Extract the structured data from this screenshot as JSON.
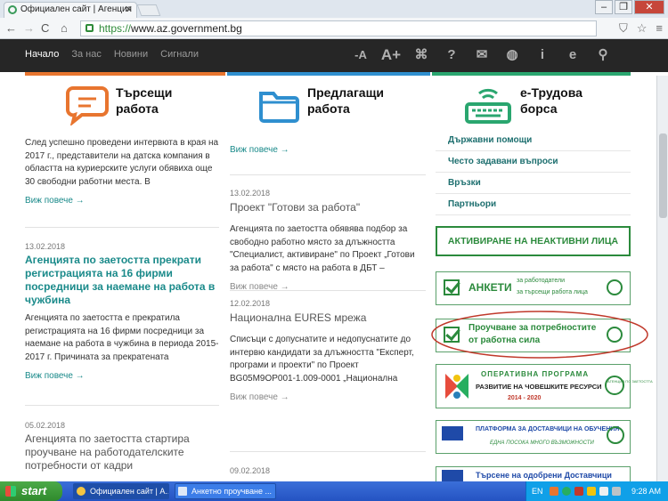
{
  "browser": {
    "tab_title": "Официален сайт | Агенция",
    "url_scheme": "https://",
    "url_host": "www.az.government.bg"
  },
  "site_nav": {
    "links": [
      "Начало",
      "За нас",
      "Новини",
      "Сигнали"
    ],
    "tools": [
      "-A",
      "A+",
      "⌘",
      "?",
      "✉",
      "◍",
      "i",
      "e",
      "⚲"
    ]
  },
  "hero": {
    "job_seekers": "Търсещи работа",
    "offering_jobs": "Предлагащи работа",
    "e_exchange": "е-Трудова борса"
  },
  "colors": {
    "orange": "#e8752f",
    "blue": "#2f8fcf",
    "green": "#2aa66f",
    "teal": "#1a8a8a"
  },
  "left_column": {
    "intro_text": "След успешно проведени интервюта в края на 2017 г., представители на датска компания в областта на куриерските услуги обявиха още 30 свободни работни места. В",
    "more_label": "Виж повече  →",
    "article2": {
      "date": "13.02.2018",
      "title": "Агенцията по заетостта прекрати регистрацията на 16 фирми посредници за наемане на работа в чужбина",
      "text": "Агенцията по заетостта е прекратила регистрацията на 16 фирми посредници за наемане на работа в чужбина в периода 2015-2017 г. Причината за прекратената"
    },
    "article3": {
      "date": "05.02.2018",
      "title": "Агенцията по заетостта стартира проучване на работодателските потребности от кадри"
    }
  },
  "middle_column": {
    "more_label": "Виж повече  →",
    "article1": {
      "date": "13.02.2018",
      "title": "Проект \"Готови за работа\"",
      "text": "Агенцията по заетостта обявява подбор за свободно работно място за длъжността \"Специалист, активиране\" по Проект „Готови за работа\" с място на работа в ДБТ –"
    },
    "article2": {
      "date": "12.02.2018",
      "title": "Национална EURES мрежа",
      "text": "Списъци с допуснатите и недопуснатите до интервю кандидати за длъжността \"Експерт, програми и проекти\" по Проект BG05M9OP001-1.009-0001 „Национална"
    },
    "article3": {
      "date": "09.02.2018"
    }
  },
  "sidebar": {
    "links": [
      "Държавни помощи",
      "Често задавани въпроси",
      "Връзки",
      "Партньори"
    ],
    "banner_activation": "АКТИВИРАНЕ НА НЕАКТИВНИ ЛИЦА",
    "banner_surveys_title": "АНКЕТИ",
    "banner_surveys_sub1": "за работодатели",
    "banner_surveys_sub2": "за търсещи работа лица",
    "banner_labour_study": "Проучване за потребностите от работна сила",
    "banner_opr_title": "ОПЕРАТИВНА ПРОГРАМА",
    "banner_opr_sub": "РАЗВИТИЕ НА ЧОВЕШКИТЕ РЕСУРСИ",
    "banner_opr_years": "2014 - 2020",
    "banner_opr_agency": "АГЕНЦИЯ ПО ЗАЕТОСТТА",
    "banner_platform_title": "ПЛАТФОРМА ЗА ДОСТАВЧИЦИ НА ОБУЧЕНИЯ",
    "banner_platform_sub": "ЕДНА ПОСОКА МНОГО ВЪЗМОЖНОСТИ",
    "banner_search_providers": "Търсене на одобрени Доставчици"
  },
  "taskbar": {
    "start": "start",
    "task1": "Официален сайт | А...",
    "task2": "Анкетно проучване ...",
    "lang": "EN",
    "time": "9:28 AM"
  }
}
